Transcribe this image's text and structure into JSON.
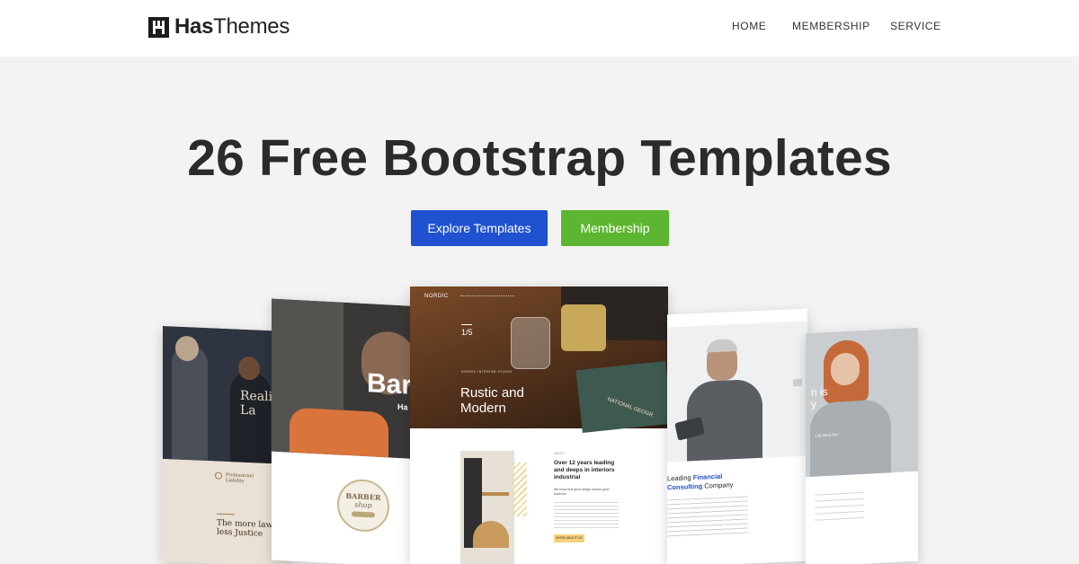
{
  "brand": {
    "name_bold": "Has",
    "name_light": "Themes"
  },
  "nav": {
    "home": "HOME",
    "membership": "MEMBERSHIP",
    "service": "SERVICE"
  },
  "hero": {
    "title": "26 Free Bootstrap Templates",
    "explore_label": "Explore Templates",
    "membership_label": "Membership",
    "explore_color": "#1f51d0",
    "membership_color": "#5db631"
  },
  "cards": {
    "legal": {
      "hero_text": "Realit\nLa",
      "badge": "Professional\nLiability",
      "quote": "The more law, the\nless Justice"
    },
    "barber": {
      "hero_text": "Bar",
      "sub_text": "Ha",
      "logo_top": "BARBER",
      "logo_bottom": "shop"
    },
    "nordic": {
      "brand": "NORDIC",
      "counter": "1/5",
      "kicker": "NORDIC INTERIOR STUDIO",
      "headline_1": "Rustic and",
      "headline_2": "Modern",
      "about_label": "ABOUT",
      "about_title": "Over 12 years leading and deeps in interiors industrial",
      "about_sub": "We know that good design means good business",
      "cta": "MORE ABOUT US",
      "book_text": "NATIONAL GEOGR"
    },
    "consulting": {
      "line_1": "Leading",
      "line_1_accent": "Financial",
      "line_2_accent": "Consulting",
      "line_2": "Company"
    },
    "health": {
      "hero_text": "n is\ny",
      "badge": "LAB HEALTHY"
    }
  }
}
